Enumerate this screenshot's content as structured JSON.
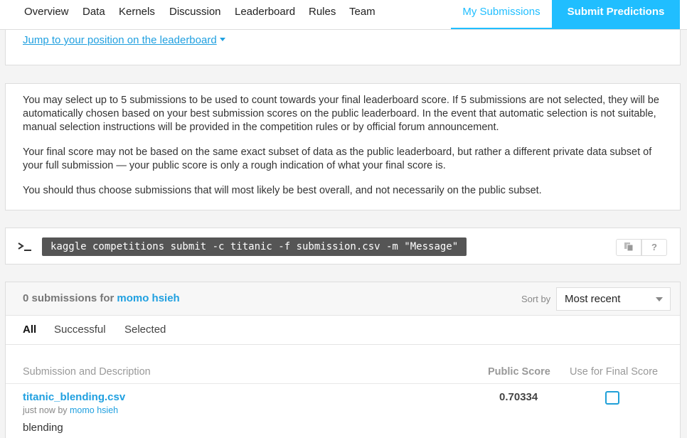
{
  "nav": {
    "tabs": [
      "Overview",
      "Data",
      "Kernels",
      "Discussion",
      "Leaderboard",
      "Rules",
      "Team"
    ],
    "my_submissions": "My Submissions",
    "submit_predictions": "Submit Predictions"
  },
  "jump": {
    "label": "Jump to your position on the leaderboard"
  },
  "info": {
    "p1": "You may select up to 5 submissions to be used to count towards your final leaderboard score. If 5 submissions are not selected, they will be automatically chosen based on your best submission scores on the public leaderboard. In the event that automatic selection is not suitable, manual selection instructions will be provided in the competition rules or by official forum announcement.",
    "p2": "Your final score may not be based on the same exact subset of data as the public leaderboard, but rather a different private data subset of your full submission — your public score is only a rough indication of what your final score is.",
    "p3": "You should thus choose submissions that will most likely be best overall, and not necessarily on the public subset."
  },
  "cli": {
    "command": "kaggle competitions submit -c titanic -f submission.csv -m \"Message\"",
    "help": "?"
  },
  "submissions": {
    "count_text": "0 submissions for",
    "user": "momo hsieh",
    "sort_label": "Sort by",
    "sort_value": "Most recent",
    "filters": [
      "All",
      "Successful",
      "Selected"
    ],
    "columns": {
      "description": "Submission and Description",
      "public_score": "Public Score",
      "final": "Use for Final Score"
    },
    "rows": [
      {
        "file": "titanic_blending.csv",
        "when": "just now by",
        "by": "momo hsieh",
        "description": "blending",
        "public_score": "0.70334",
        "selected": false
      }
    ]
  },
  "colors": {
    "accent": "#20beff",
    "link": "#20a0e0"
  }
}
